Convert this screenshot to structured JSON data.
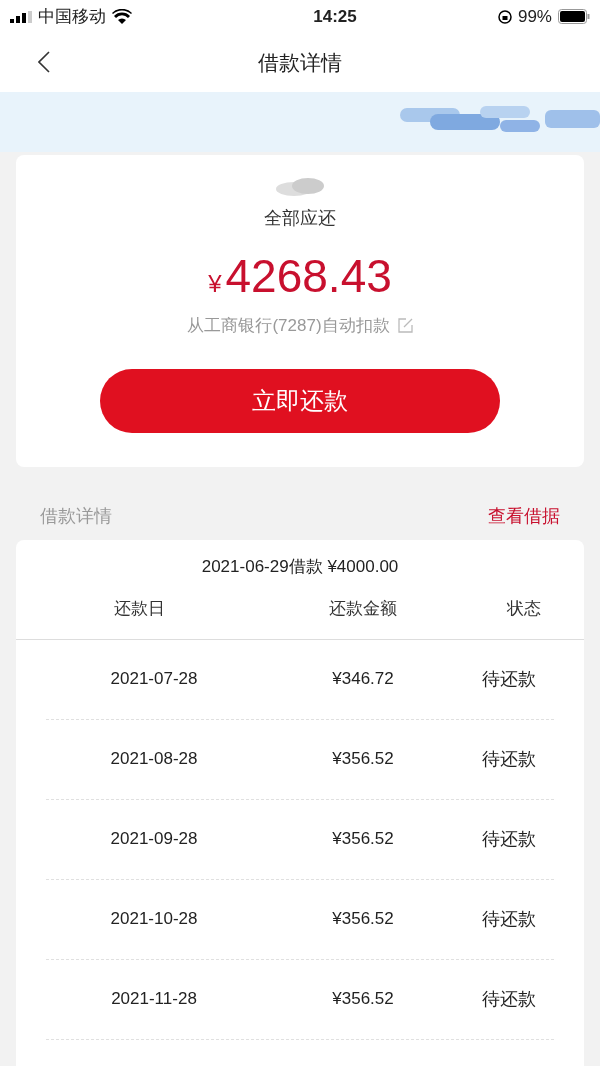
{
  "status_bar": {
    "carrier": "中国移动",
    "time": "14:25",
    "battery": "99%"
  },
  "nav": {
    "title": "借款详情"
  },
  "summary": {
    "label": "全部应还",
    "currency": "¥",
    "amount": "4268.43",
    "autopay": "从工商银行(7287)自动扣款",
    "button": "立即还款"
  },
  "section": {
    "title": "借款详情",
    "link": "查看借据"
  },
  "loan": {
    "title": "2021-06-29借款 ¥4000.00",
    "columns": [
      "还款日",
      "还款金额",
      "状态"
    ],
    "rows": [
      {
        "date": "2021-07-28",
        "amount": "¥346.72",
        "status": "待还款"
      },
      {
        "date": "2021-08-28",
        "amount": "¥356.52",
        "status": "待还款"
      },
      {
        "date": "2021-09-28",
        "amount": "¥356.52",
        "status": "待还款"
      },
      {
        "date": "2021-10-28",
        "amount": "¥356.52",
        "status": "待还款"
      },
      {
        "date": "2021-11-28",
        "amount": "¥356.52",
        "status": "待还款"
      }
    ]
  }
}
